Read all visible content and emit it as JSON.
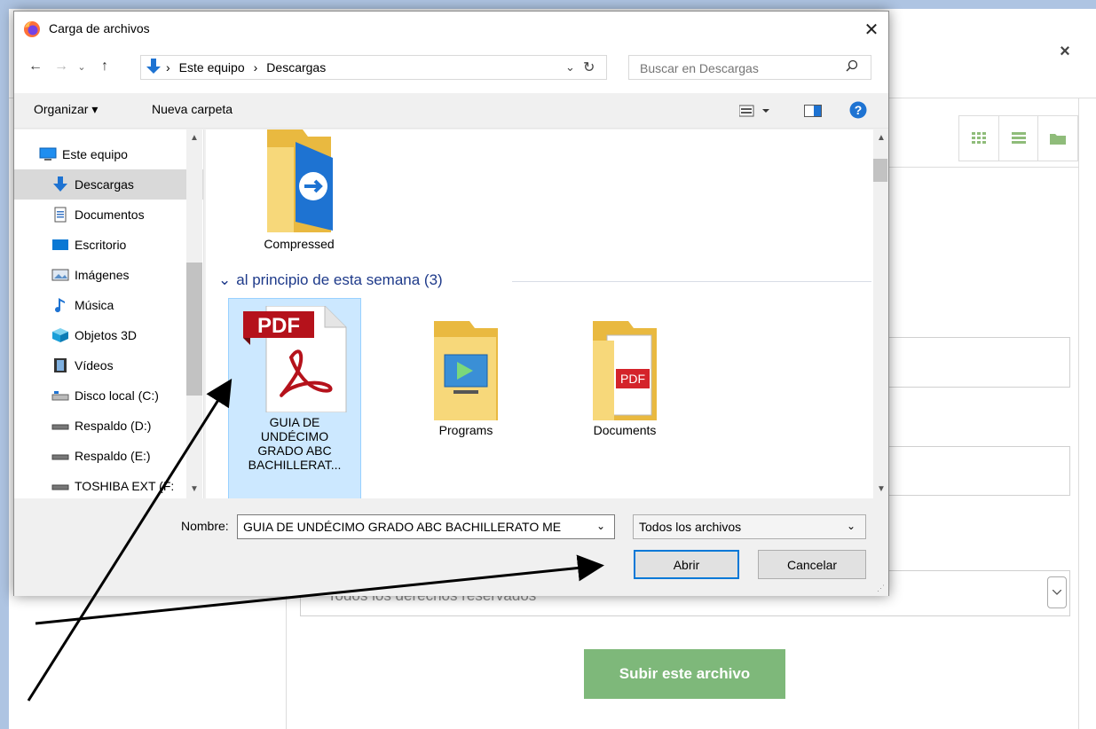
{
  "background_page": {
    "close_glyph": "×",
    "license_text": "Todos los derechos reservados",
    "upload_button": "Subir este archivo",
    "upload_button_color": "#7eb87a"
  },
  "dialog": {
    "title": "Carga de archivos",
    "close_glyph": "✕",
    "breadcrumb": [
      "Este equipo",
      "Descargas"
    ],
    "breadcrumb_sep": "›",
    "search_placeholder": "Buscar en Descargas",
    "organize": "Organizar ▾",
    "new_folder": "Nueva carpeta",
    "nav_items": [
      {
        "label": "Este equipo",
        "icon": "computer-icon"
      },
      {
        "label": "Descargas",
        "icon": "downloads-icon"
      },
      {
        "label": "Documentos",
        "icon": "documents-icon"
      },
      {
        "label": "Escritorio",
        "icon": "desktop-icon"
      },
      {
        "label": "Imágenes",
        "icon": "pictures-icon"
      },
      {
        "label": "Música",
        "icon": "music-icon"
      },
      {
        "label": "Objetos 3D",
        "icon": "objects3d-icon"
      },
      {
        "label": "Vídeos",
        "icon": "videos-icon"
      },
      {
        "label": "Disco local (C:)",
        "icon": "drive-icon"
      },
      {
        "label": "Respaldo (D:)",
        "icon": "drive-icon"
      },
      {
        "label": "Respaldo (E:)",
        "icon": "drive-icon"
      },
      {
        "label": "TOSHIBA EXT (F:",
        "icon": "drive-icon"
      }
    ],
    "group_header": "al principio de esta semana (3)",
    "files": {
      "compressed": "Compressed",
      "pdf_lines": [
        "GUIA DE",
        "UNDÉCIMO",
        "GRADO ABC",
        "BACHILLERAT..."
      ],
      "pdf_badge": "PDF",
      "programs": "Programs",
      "documents": "Documents"
    },
    "name_label": "Nombre:",
    "name_value": "GUIA DE UNDÉCIMO GRADO ABC BACHILLERATO ME",
    "file_type": "Todos los archivos",
    "open_button": "Abrir",
    "cancel_button": "Cancelar"
  },
  "colors": {
    "accent": "#0078d7",
    "selection": "#cce8ff",
    "group_header": "#1e3a8a"
  }
}
